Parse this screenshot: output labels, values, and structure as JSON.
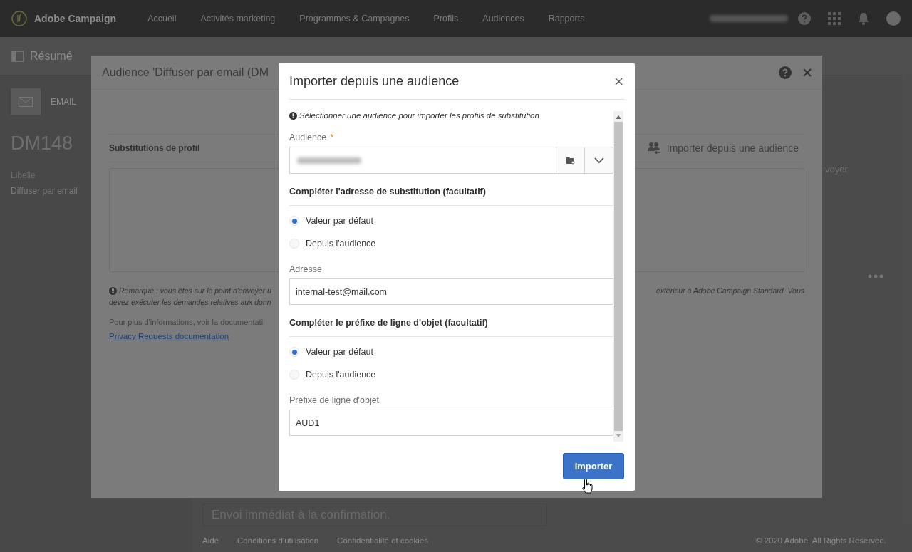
{
  "top_bar": {
    "brand": "Adobe Campaign",
    "nav": [
      {
        "label": "Accueil"
      },
      {
        "label": "Activités marketing"
      },
      {
        "label": "Programmes & Campagnes"
      },
      {
        "label": "Profils"
      },
      {
        "label": "Audiences"
      },
      {
        "label": "Rapports"
      }
    ]
  },
  "page": {
    "title": "Résumé",
    "channel_tab": "EMAIL",
    "code": "DM148",
    "field_label": "Libellé",
    "field_value": "Diffuser par email",
    "right_fragment": "voyer",
    "schedule": "Envoi immédiat à la confirmation."
  },
  "footer": {
    "links": [
      "Aide",
      "Conditions d'utilisation",
      "Confidentialité et cookies"
    ],
    "copyright": "© 2020 Adobe. All Rights Reserved."
  },
  "audience_modal": {
    "title": "Audience 'Diffuser par email (DM",
    "section": "Substitutions de profil",
    "import_action": "Importer depuis une audience",
    "remark_lines": [
      "Remarque : vous êtes sur le point d'envoyer u",
      "devez exécuter les demandes relatives aux donn"
    ],
    "remark_end": "extérieur à Adobe Campaign Standard. Vous",
    "more_info": "Pour plus d'informations, voir la documentati",
    "link": "Privacy Requests documentation"
  },
  "import_dialog": {
    "title": "Importer depuis une audience",
    "hint": "Sélectionner une audience pour importer les profils de substitution",
    "audience_label": "Audience",
    "required_mark": "*",
    "sections": [
      {
        "title": "Compléter l'adresse de substitution (facultatif)",
        "options": [
          {
            "label": "Valeur par défaut",
            "selected": true
          },
          {
            "label": "Depuis l'audience",
            "selected": false
          }
        ],
        "field_label": "Adresse",
        "field_value": "internal-test@mail.com"
      },
      {
        "title": "Compléter le préfixe de ligne d'objet (facultatif)",
        "options": [
          {
            "label": "Valeur par défaut",
            "selected": true
          },
          {
            "label": "Depuis l'audience",
            "selected": false
          }
        ],
        "field_label": "Préfixe de ligne d'objet",
        "field_value": "AUD1"
      }
    ],
    "button": "Importer"
  }
}
